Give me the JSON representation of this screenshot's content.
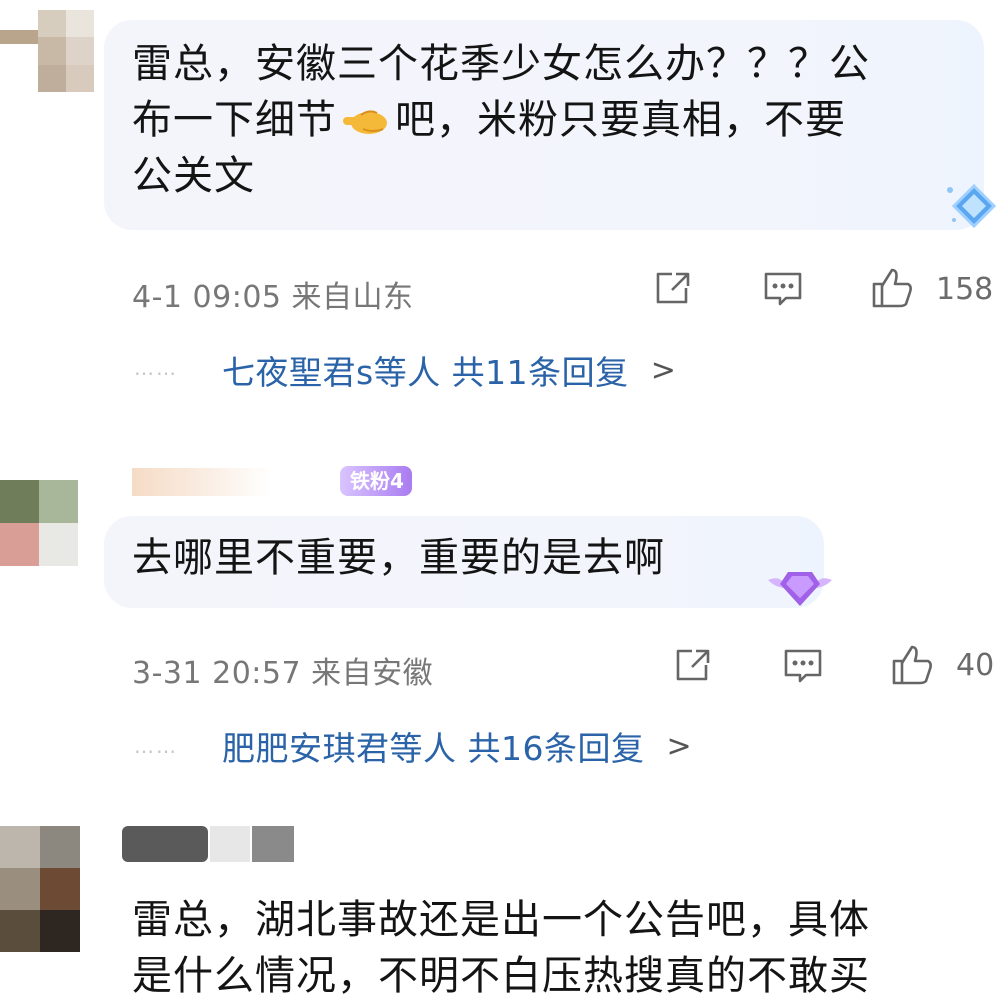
{
  "comments": [
    {
      "text_line1": "雷总，安徽三个花季少女怎么办？？？公",
      "text_line2_before": "布一下细节",
      "text_line2_emoji": "pointing-hand-emoji",
      "text_line2_after": "吧，米粉只要真相，不要",
      "text_line3": "公关文",
      "meta": "4-1 09:05 来自山东",
      "like_count": "158",
      "replies_text": "七夜聖君s等人 共11条回复",
      "replies_arrow": ">"
    },
    {
      "fan_badge": "铁粉4",
      "text_line1": "去哪里不重要，重要的是去啊",
      "meta": "3-31 20:57 来自安徽",
      "like_count": "40",
      "replies_text": "肥肥安琪君等人 共16条回复",
      "replies_arrow": ">"
    },
    {
      "text_line1": "雷总，湖北事故还是出一个公告吧，具体",
      "text_line2": "是什么情况，不明不白压热搜真的不敢买"
    }
  ],
  "dots": "……",
  "icons": {
    "share": "share-icon",
    "comment": "comment-icon",
    "like": "thumbs-up-icon",
    "diamond": "diamond-badge-icon",
    "crown": "purple-gem-badge-icon"
  },
  "colors": {
    "reply_link": "#2a63a8",
    "meta_gray": "#777777",
    "bubble_bg": "#f3f5fb"
  }
}
